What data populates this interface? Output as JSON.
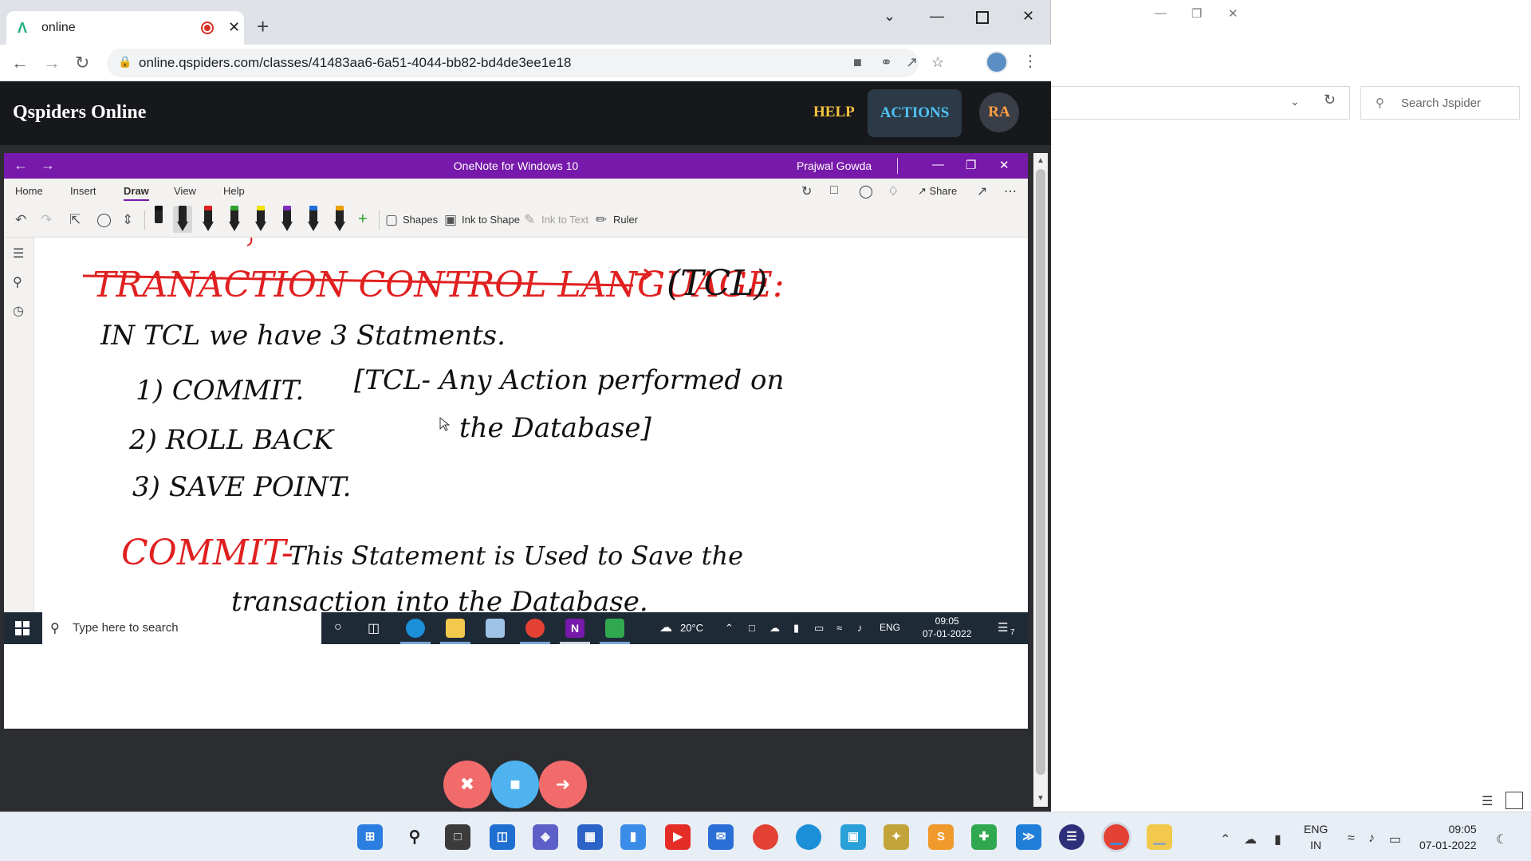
{
  "background_window": {
    "search_placeholder": "Search Jspider",
    "minimize_icon": "minimize-icon",
    "restore_icon": "restore-icon",
    "close_icon": "close-icon"
  },
  "browser": {
    "tab_title": "online",
    "url": "online.qspiders.com/classes/41483aa6-6a51-4044-bb82-bd4de3ee1e18"
  },
  "app": {
    "brand": "Qspiders Online",
    "help_label": "HELP",
    "actions_label": "ACTIONS",
    "avatar_initials": "RA"
  },
  "onenote": {
    "window_title": "OneNote for Windows 10",
    "user_name": "Prajwal Gowda",
    "menu": [
      "Home",
      "Insert",
      "Draw",
      "View",
      "Help"
    ],
    "active_menu": "Draw",
    "share_label": "Share",
    "tools": {
      "shapes": "Shapes",
      "ink_to_shape": "Ink to Shape",
      "ink_to_text": "Ink to Text",
      "ruler": "Ruler"
    },
    "pen_colors": [
      "#111111",
      "#111111",
      "#e02020",
      "#2aa12a",
      "#f5e300",
      "#7b2fbf",
      "#1e6fd9",
      "#f0a000"
    ],
    "notes": {
      "heading": "TRANACTION CONTROL LANGUAGE:",
      "heading_abbr": "(TCL)",
      "intro": "IN TCL we have 3 Statments.",
      "item1": "1) COMMIT.",
      "item2": "2) ROLL BACK",
      "item3": "3) SAVE POINT.",
      "bracket_line1": "[TCL- Any Action performed on",
      "bracket_line2": "the Database]",
      "commit_label": "COMMIT-",
      "commit_line1": "This Statement is Used to Save the",
      "commit_line2": "transaction into the Database."
    }
  },
  "shared_taskbar": {
    "search_placeholder": "Type here to search",
    "temperature": "20°C",
    "language": "ENG",
    "time": "09:05",
    "date": "07-01-2022",
    "notification_count": "7"
  },
  "system_taskbar": {
    "language_line1": "ENG",
    "language_line2": "IN",
    "time": "09:05",
    "date": "07-01-2022"
  }
}
